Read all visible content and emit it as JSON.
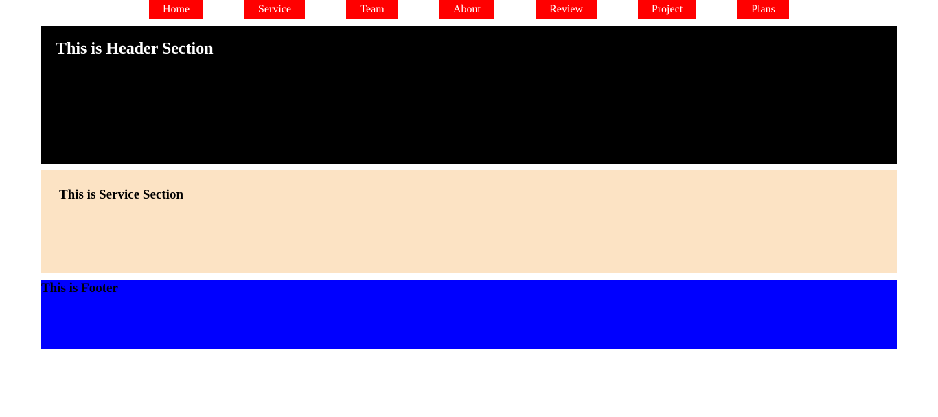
{
  "nav": {
    "items": [
      {
        "label": "Home"
      },
      {
        "label": "Service"
      },
      {
        "label": "Team"
      },
      {
        "label": "About"
      },
      {
        "label": "Review"
      },
      {
        "label": "Project"
      },
      {
        "label": "Plans"
      }
    ],
    "item_color": "#ff0000",
    "text_color": "#ffffff"
  },
  "header": {
    "title": "This is Header Section",
    "background": "#000000",
    "text_color": "#ffffff"
  },
  "service": {
    "title": "This is Service Section",
    "background": "#fce3c4",
    "text_color": "#000000"
  },
  "footer": {
    "title": "This is Footer",
    "background": "#0000ff",
    "text_color": "#000000"
  }
}
